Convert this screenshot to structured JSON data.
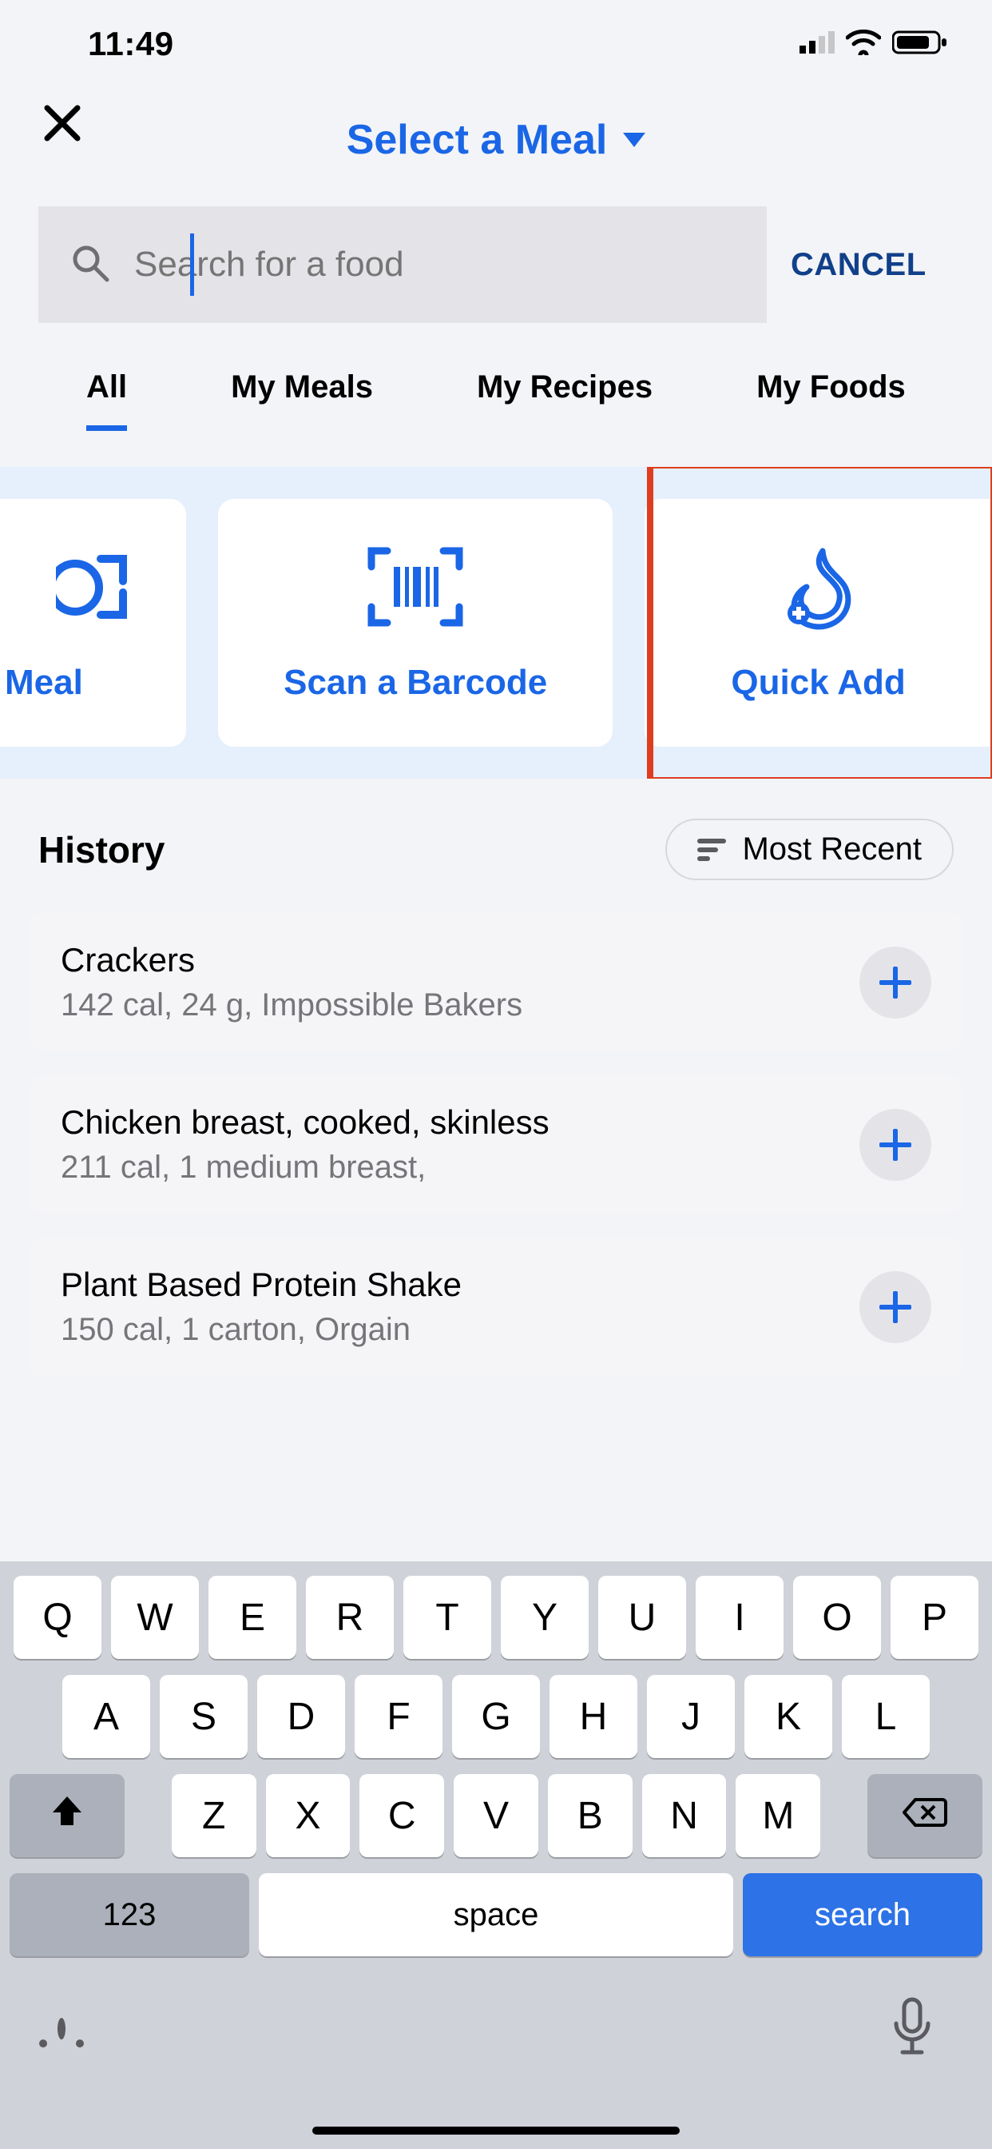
{
  "status": {
    "time": "11:49"
  },
  "header": {
    "title": "Select a Meal"
  },
  "search": {
    "placeholder": "Search for a food",
    "cancel": "CANCEL"
  },
  "tabs": [
    "All",
    "My Meals",
    "My Recipes",
    "My Foods"
  ],
  "actionCards": {
    "scanMeal": "Meal",
    "scanBarcode": "Scan a Barcode",
    "quickAdd": "Quick Add"
  },
  "history": {
    "title": "History",
    "sort": "Most Recent",
    "items": [
      {
        "name": "Crackers",
        "sub": "142 cal, 24 g, Impossible Bakers"
      },
      {
        "name": "Chicken breast, cooked, skinless",
        "sub": "211 cal, 1 medium breast,"
      },
      {
        "name": "Plant Based Protein Shake",
        "sub": "150 cal, 1 carton, Orgain"
      }
    ]
  },
  "keyboard": {
    "row1": [
      "Q",
      "W",
      "E",
      "R",
      "T",
      "Y",
      "U",
      "I",
      "O",
      "P"
    ],
    "row2": [
      "A",
      "S",
      "D",
      "F",
      "G",
      "H",
      "J",
      "K",
      "L"
    ],
    "row3": [
      "Z",
      "X",
      "C",
      "V",
      "B",
      "N",
      "M"
    ],
    "numKey": "123",
    "space": "space",
    "action": "search"
  }
}
